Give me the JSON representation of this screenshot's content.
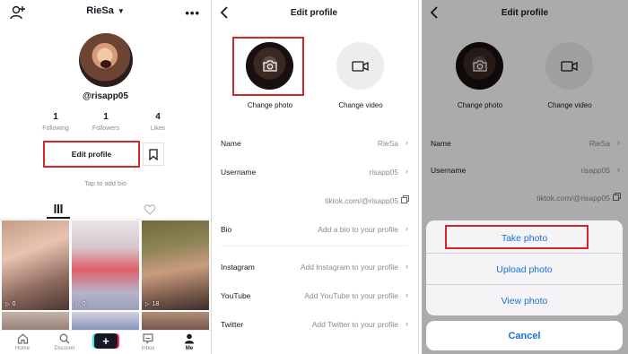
{
  "profile": {
    "username": "RieSa",
    "handle": "@risapp05",
    "stats": [
      {
        "value": "1",
        "label": "Following"
      },
      {
        "value": "1",
        "label": "Followers"
      },
      {
        "value": "4",
        "label": "Likes"
      }
    ],
    "edit_button": "Edit profile",
    "bio_hint": "Tap to add bio",
    "videos": [
      {
        "views": "0"
      },
      {
        "views": "0"
      },
      {
        "views": "18"
      }
    ],
    "nav": [
      {
        "label": "Home",
        "icon": "home-icon"
      },
      {
        "label": "Discover",
        "icon": "search-icon"
      },
      {
        "label": "",
        "icon": "plus-icon"
      },
      {
        "label": "Inbox",
        "icon": "inbox-icon"
      },
      {
        "label": "Me",
        "icon": "person-icon"
      }
    ]
  },
  "edit_profile": {
    "title": "Edit profile",
    "change_photo": "Change photo",
    "change_video": "Change video",
    "fields": [
      {
        "label": "Name",
        "value": "RieSa"
      },
      {
        "label": "Username",
        "value": "risapp05"
      },
      {
        "label": "",
        "value": "tiktok.com/@risapp05"
      },
      {
        "label": "Bio",
        "value": "Add a bio to your profile"
      },
      {
        "label": "Instagram",
        "value": "Add Instagram to your profile"
      },
      {
        "label": "YouTube",
        "value": "Add YouTube to your profile"
      },
      {
        "label": "Twitter",
        "value": "Add Twitter to your profile"
      }
    ]
  },
  "action_sheet": {
    "title": "Edit profile",
    "change_photo": "Change photo",
    "change_video": "Change video",
    "fields": [
      {
        "label": "Name",
        "value": "RieSa"
      },
      {
        "label": "Username",
        "value": "risapp05"
      },
      {
        "label": "",
        "value": "tiktok.com/@risapp05"
      }
    ],
    "options": [
      "Take photo",
      "Upload photo",
      "View photo"
    ],
    "cancel": "Cancel"
  },
  "colors": {
    "highlight": "#d7262a",
    "ios_blue": "#1f6fd1",
    "text": "#161823",
    "muted": "#8a8b91"
  }
}
